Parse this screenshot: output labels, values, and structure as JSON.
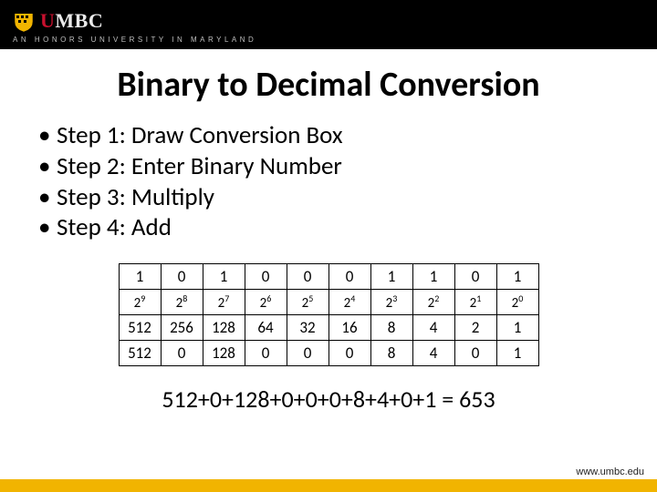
{
  "chart_data": {
    "type": "table",
    "rows": [
      [
        "1",
        "0",
        "1",
        "0",
        "0",
        "0",
        "1",
        "1",
        "0",
        "1"
      ],
      [
        "2^9",
        "2^8",
        "2^7",
        "2^6",
        "2^5",
        "2^4",
        "2^3",
        "2^2",
        "2^1",
        "2^0"
      ],
      [
        "512",
        "256",
        "128",
        "64",
        "32",
        "16",
        "8",
        "4",
        "2",
        "1"
      ],
      [
        "512",
        "0",
        "128",
        "0",
        "0",
        "0",
        "8",
        "4",
        "0",
        "1"
      ]
    ]
  },
  "header": {
    "logo": {
      "red_letters": "U",
      "rest": "MBC"
    },
    "tagline": "AN HONORS UNIVERSITY IN MARYLAND"
  },
  "title": "Binary to Decimal Conversion",
  "bullets": [
    "Step 1: Draw Conversion Box",
    "Step 2: Enter Binary Number",
    "Step 3: Multiply",
    "Step 4: Add"
  ],
  "table": {
    "row_binary": [
      "1",
      "0",
      "1",
      "0",
      "0",
      "0",
      "1",
      "1",
      "0",
      "1"
    ],
    "row_powers": [
      {
        "base": "2",
        "exp": "9"
      },
      {
        "base": "2",
        "exp": "8"
      },
      {
        "base": "2",
        "exp": "7"
      },
      {
        "base": "2",
        "exp": "6"
      },
      {
        "base": "2",
        "exp": "5"
      },
      {
        "base": "2",
        "exp": "4"
      },
      {
        "base": "2",
        "exp": "3"
      },
      {
        "base": "2",
        "exp": "2"
      },
      {
        "base": "2",
        "exp": "1"
      },
      {
        "base": "2",
        "exp": "0"
      }
    ],
    "row_values": [
      "512",
      "256",
      "128",
      "64",
      "32",
      "16",
      "8",
      "4",
      "2",
      "1"
    ],
    "row_products": [
      "512",
      "0",
      "128",
      "0",
      "0",
      "0",
      "8",
      "4",
      "0",
      "1"
    ]
  },
  "equation": "512+0+128+0+0+0+8+4+0+1 = 653",
  "footer_url": "www.umbc.edu"
}
